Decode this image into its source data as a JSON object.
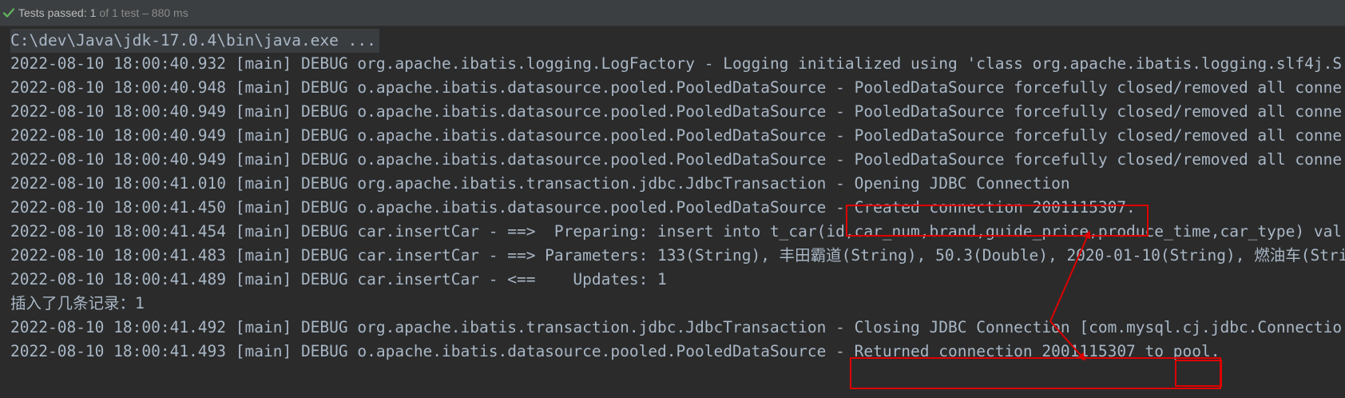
{
  "status": {
    "passed_label": "Tests passed:",
    "passed_count": "1",
    "detail": "of 1 test – 880 ms",
    "icon": "check-icon",
    "icon_color": "#5fb05f"
  },
  "console": {
    "command": "C:\\dev\\Java\\jdk-17.0.4\\bin\\java.exe ...",
    "lines": [
      "2022-08-10 18:00:40.932 [main] DEBUG org.apache.ibatis.logging.LogFactory - Logging initialized using 'class org.apache.ibatis.logging.slf4j.S",
      "2022-08-10 18:00:40.948 [main] DEBUG o.apache.ibatis.datasource.pooled.PooledDataSource - PooledDataSource forcefully closed/removed all conne",
      "2022-08-10 18:00:40.949 [main] DEBUG o.apache.ibatis.datasource.pooled.PooledDataSource - PooledDataSource forcefully closed/removed all conne",
      "2022-08-10 18:00:40.949 [main] DEBUG o.apache.ibatis.datasource.pooled.PooledDataSource - PooledDataSource forcefully closed/removed all conne",
      "2022-08-10 18:00:40.949 [main] DEBUG o.apache.ibatis.datasource.pooled.PooledDataSource - PooledDataSource forcefully closed/removed all conne",
      "2022-08-10 18:00:41.010 [main] DEBUG org.apache.ibatis.transaction.jdbc.JdbcTransaction - Opening JDBC Connection",
      "2022-08-10 18:00:41.450 [main] DEBUG o.apache.ibatis.datasource.pooled.PooledDataSource - Created connection 2001115307.",
      "2022-08-10 18:00:41.454 [main] DEBUG car.insertCar - ==>  Preparing: insert into t_car(id,car_num,brand,guide_price,produce_time,car_type) val",
      "2022-08-10 18:00:41.483 [main] DEBUG car.insertCar - ==> Parameters: 133(String), 丰田霸道(String), 50.3(Double), 2020-01-10(String), 燃油车(Stri",
      "2022-08-10 18:00:41.489 [main] DEBUG car.insertCar - <==    Updates: 1",
      "插入了几条记录：1",
      "2022-08-10 18:00:41.492 [main] DEBUG org.apache.ibatis.transaction.jdbc.JdbcTransaction - Closing JDBC Connection [com.mysql.cj.jdbc.Connectio",
      "2022-08-10 18:00:41.493 [main] DEBUG o.apache.ibatis.datasource.pooled.PooledDataSource - Returned connection 2001115307 to pool."
    ]
  },
  "annotation_color": "#e00000"
}
